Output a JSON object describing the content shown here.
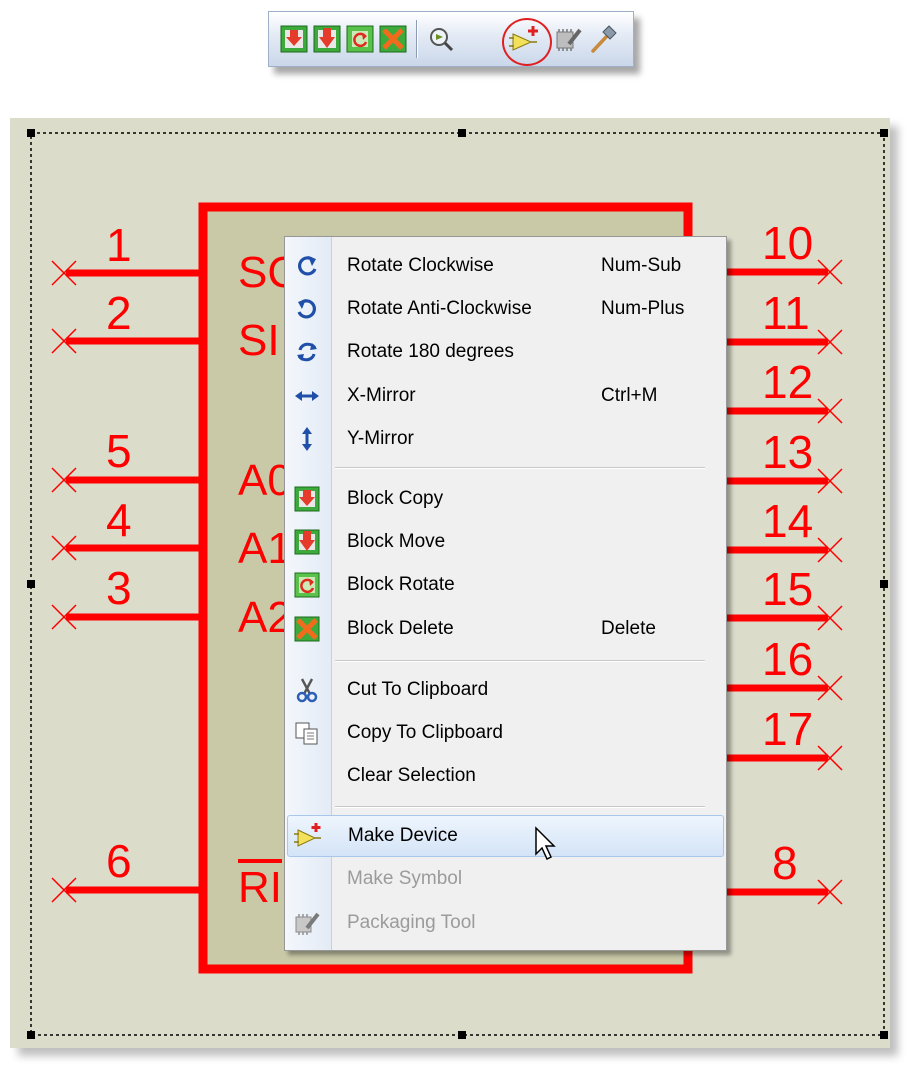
{
  "toolbar": {
    "buttons": [
      {
        "icon": "block-copy-icon"
      },
      {
        "icon": "block-move-icon"
      },
      {
        "icon": "block-rotate-icon"
      },
      {
        "icon": "block-delete-icon"
      },
      {
        "icon": "zoom-icon"
      },
      {
        "icon": "make-device-icon",
        "highlighted": true
      },
      {
        "icon": "packaging-tool-icon"
      },
      {
        "icon": "hammer-icon"
      }
    ]
  },
  "schematic": {
    "pins_left": [
      {
        "number": "1",
        "label": "SC"
      },
      {
        "number": "2",
        "label": "SI"
      },
      {
        "number": "5",
        "label": "A0"
      },
      {
        "number": "4",
        "label": "A1"
      },
      {
        "number": "3",
        "label": "A2"
      },
      {
        "number": "6",
        "label": "RI"
      }
    ],
    "pins_right": [
      {
        "number": "10"
      },
      {
        "number": "11"
      },
      {
        "number": "12"
      },
      {
        "number": "13"
      },
      {
        "number": "14"
      },
      {
        "number": "15"
      },
      {
        "number": "16"
      },
      {
        "number": "17"
      },
      {
        "number": "8"
      }
    ],
    "line_color": "#ff0000",
    "body_fill": "#c9c9a8",
    "canvas_color": "#dcdccb"
  },
  "context_menu": {
    "items": [
      {
        "label": "Rotate Clockwise",
        "shortcut": "Num-Sub",
        "icon": "rotate-cw-icon",
        "enabled": true
      },
      {
        "label": "Rotate Anti-Clockwise",
        "shortcut": "Num-Plus",
        "icon": "rotate-ccw-icon",
        "enabled": true
      },
      {
        "label": "Rotate 180 degrees",
        "shortcut": "",
        "icon": "rotate-180-icon",
        "enabled": true
      },
      {
        "label": "X-Mirror",
        "shortcut": "Ctrl+M",
        "icon": "x-mirror-icon",
        "enabled": true
      },
      {
        "label": "Y-Mirror",
        "shortcut": "",
        "icon": "y-mirror-icon",
        "enabled": true
      },
      {
        "label": "Block Copy",
        "shortcut": "",
        "icon": "block-copy-icon",
        "enabled": true
      },
      {
        "label": "Block Move",
        "shortcut": "",
        "icon": "block-move-icon",
        "enabled": true
      },
      {
        "label": "Block Rotate",
        "shortcut": "",
        "icon": "block-rotate-icon",
        "enabled": true
      },
      {
        "label": "Block Delete",
        "shortcut": "Delete",
        "icon": "block-delete-icon",
        "enabled": true
      },
      {
        "label": "Cut To Clipboard",
        "shortcut": "",
        "icon": "scissors-icon",
        "enabled": true
      },
      {
        "label": "Copy To Clipboard",
        "shortcut": "",
        "icon": "copy-icon",
        "enabled": true
      },
      {
        "label": "Clear Selection",
        "shortcut": "",
        "icon": "",
        "enabled": true
      },
      {
        "label": "Make Device",
        "shortcut": "",
        "icon": "make-device-icon",
        "enabled": true,
        "hovered": true
      },
      {
        "label": "Make Symbol",
        "shortcut": "",
        "icon": "",
        "enabled": false
      },
      {
        "label": "Packaging Tool",
        "shortcut": "",
        "icon": "packaging-tool-icon",
        "enabled": false
      }
    ]
  }
}
